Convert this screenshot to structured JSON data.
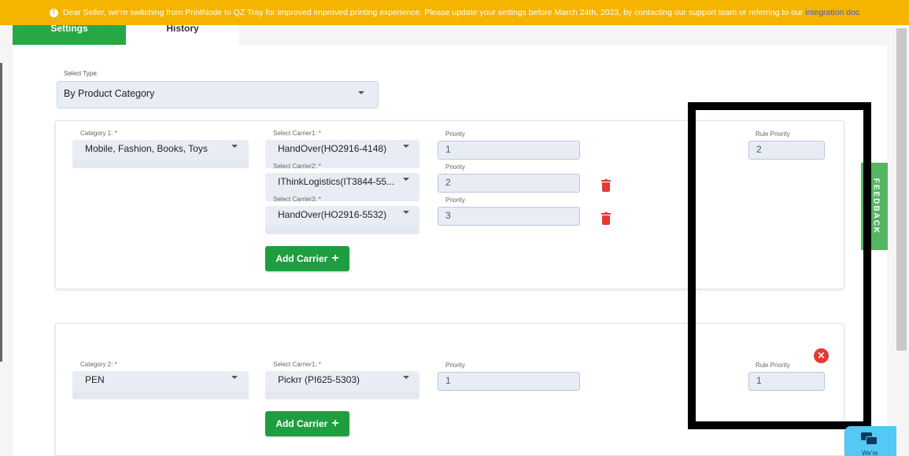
{
  "banner": {
    "message": "Dear Seller, we're switching from PrintNode to QZ Tray for improved improved printing experience. Please update your settings before March 24th, 2023, by contacting our support team or referring to our",
    "link": "integration doc"
  },
  "tabs": {
    "settings": "Settings",
    "history": "History"
  },
  "select_type": {
    "label": "Select Type:",
    "value": "By Product Category"
  },
  "rules": [
    {
      "category_label": "Category 1: *",
      "category_value": "Mobile, Fashion, Books, Toys",
      "carriers": [
        {
          "label": "Select Carrier1: *",
          "value": "HandOver(HO2916-4148)",
          "priority_label": "Priority",
          "priority": "1"
        },
        {
          "label": "Select Carrier2: *",
          "value": "IThinkLogistics(IT3844-55...",
          "priority_label": "Priority",
          "priority": "2"
        },
        {
          "label": "Select Carrier3: *",
          "value": "HandOver(HO2916-5532)",
          "priority_label": "Priority",
          "priority": "3"
        }
      ],
      "rule_priority_label": "Rule Priority",
      "rule_priority": "2",
      "add_carrier": "Add Carrier"
    },
    {
      "category_label": "Category 2: *",
      "category_value": "PEN",
      "carriers": [
        {
          "label": "Select Carrier1: *",
          "value": "Pickrr (PI625-5303)",
          "priority_label": "Priority",
          "priority": "1"
        }
      ],
      "rule_priority_label": "Rule Priority",
      "rule_priority": "1",
      "add_carrier": "Add Carrier"
    }
  ],
  "feedback": "FEEDBACK",
  "chat": {
    "label": "We're"
  },
  "colors": {
    "banner": "#f5b400",
    "primary_green": "#27a844",
    "danger": "#e53935",
    "field_bg": "#e8edf5"
  }
}
